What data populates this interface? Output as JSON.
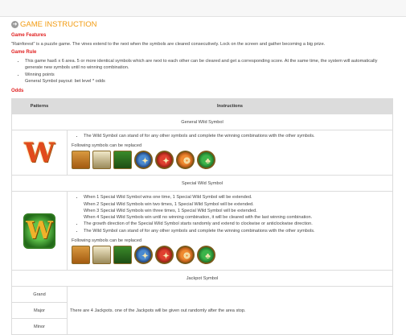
{
  "header": {
    "arrow_icon": "arrow-right-circle-icon",
    "title": "GAME INSTRUCTION"
  },
  "features": {
    "heading": "Game Features",
    "text": "\"Rainforest\" is a puzzle game. The vines extend to the next when the symbols are cleared consecutively. Lock on the screen and gather becoming a big prize."
  },
  "rule": {
    "heading": "Game Rule",
    "line1a": "This game has6 x 6 area. 5 or more identical symbols which are next to each other can be cleared and get a corresponding score. At the same time, the system will automatically",
    "line1b": "generate new symbols until no winning combination.",
    "line2": "Winning points",
    "line3": "General Symbol payout: bet level * odds"
  },
  "odds": {
    "heading": "Odds"
  },
  "table": {
    "col_patterns": "Patterns",
    "col_instructions": "Instructions",
    "general": {
      "title": "General Wild Symbol",
      "bullet": "The Wild Symbol can stand of for any other symbols and complete the winning combinations with the other symbols.",
      "follow": "Following symbols can be replaced"
    },
    "special": {
      "title": "Special Wild Symbol",
      "b1": "When 1 Special Wild Symbol wins one time, 1 Special Wild Symbol will be extended.",
      "b1a": "When 2 Special Wild Symbols win two times, 1 Special Wild Symbol will be extended.",
      "b1b": "When 3 Special Wild Symbols win three times, 1 Special Wild Symbol will be extended.",
      "b1c": "When 4 Special Wild Symbols win until no winning combination, it will be cleared with the last winning combination.",
      "b2": "The growth direction of the Special Wild Symbol starts randomly and extend to clockwise or anticlockwise direction.",
      "b3": "The Wild Symbol can stand of for any other symbols and complete the winning combinations with the other symbols.",
      "follow": "Following symbols can be replaced"
    },
    "jackpot": {
      "title": "Jackpot Symbol",
      "names": [
        "Grand",
        "Major",
        "Minor"
      ],
      "desc": "There are 4 Jackpots. one of the Jackpots will be given out randomly after the area stop."
    }
  },
  "wild_letter": "W",
  "symbol_glyphs": {
    "blue": "✦",
    "red": "✦",
    "orange": "❂",
    "green": "♣"
  },
  "colors": {
    "title_orange": "#f39c12",
    "heading_red": "#e02020",
    "table_header_bg": "#dcdcdc"
  }
}
